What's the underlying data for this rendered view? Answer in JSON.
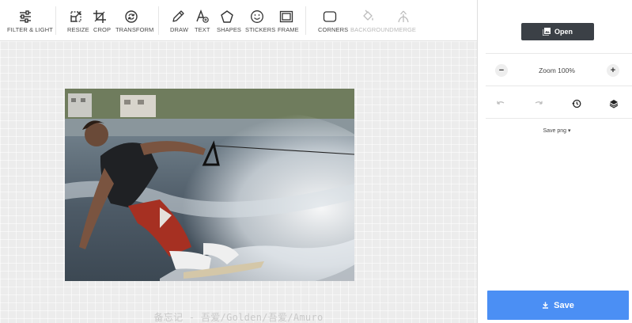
{
  "toolbar": {
    "tools": [
      {
        "label": "FILTER & LIGHT",
        "icon": "sliders-icon",
        "disabled": false
      },
      {
        "label": "RESIZE",
        "icon": "resize-icon",
        "disabled": false
      },
      {
        "label": "CROP",
        "icon": "crop-icon",
        "disabled": false
      },
      {
        "label": "TRANSFORM",
        "icon": "rotate-icon",
        "disabled": false
      },
      {
        "label": "DRAW",
        "icon": "pencil-icon",
        "disabled": false
      },
      {
        "label": "TEXT",
        "icon": "text-icon",
        "disabled": false
      },
      {
        "label": "SHAPES",
        "icon": "pentagon-icon",
        "disabled": false
      },
      {
        "label": "STICKERS",
        "icon": "smiley-icon",
        "disabled": false
      },
      {
        "label": "FRAME",
        "icon": "frame-icon",
        "disabled": false
      },
      {
        "label": "CORNERS",
        "icon": "rounded-rect-icon",
        "disabled": false
      },
      {
        "label": "BACKGROUND",
        "icon": "paint-bucket-icon",
        "disabled": true
      },
      {
        "label": "MERGE",
        "icon": "merge-icon",
        "disabled": true
      }
    ]
  },
  "canvas": {
    "watermark": "备忘记 - 吾爱/Golden/吾爱/Amuro"
  },
  "panel": {
    "open_label": "Open",
    "zoom_label": "Zoom",
    "zoom_value": "100%",
    "zoom_out": "−",
    "zoom_in": "+",
    "save_format": "Save png ▾",
    "save_label": "Save"
  },
  "colors": {
    "accent": "#4b8ff4",
    "open_button": "#3b4046",
    "disabled_text": "#b9b9b9"
  }
}
